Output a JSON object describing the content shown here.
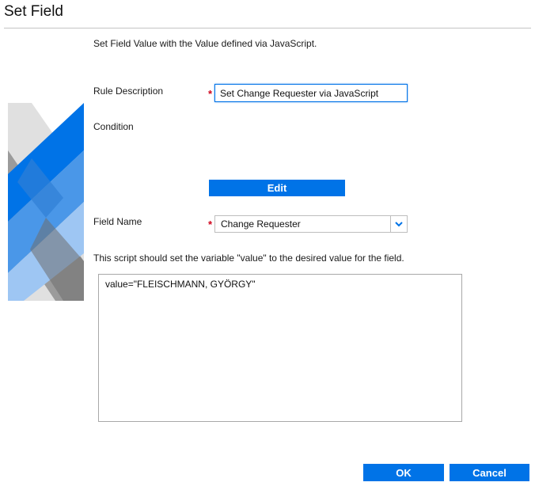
{
  "dialog": {
    "title": "Set Field",
    "intro": "Set Field Value with the Value defined via JavaScript."
  },
  "rule_description": {
    "label": "Rule Description",
    "required_marker": "*",
    "value": "Set Change Requester via JavaScript"
  },
  "condition": {
    "label": "Condition",
    "edit_label": "Edit"
  },
  "field_name": {
    "label": "Field Name",
    "required_marker": "*",
    "selected": "Change Requester"
  },
  "script": {
    "instructions": "This script should set the variable \"value\" to the desired value for the field.",
    "content": "value=\"FLEISCHMANN, GYÖRGY\""
  },
  "footer": {
    "ok_label": "OK",
    "cancel_label": "Cancel"
  },
  "colors": {
    "accent": "#0073e7",
    "required": "#d0021b"
  },
  "icons": {
    "dropdown": "chevron-down-icon",
    "brand": "brand-logo"
  }
}
